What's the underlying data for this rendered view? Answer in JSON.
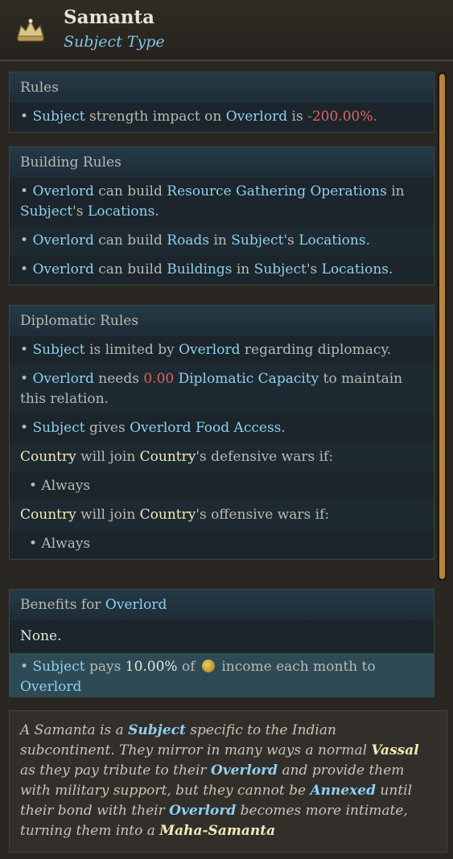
{
  "header": {
    "title": "Samanta",
    "subtitle": "Subject Type",
    "icon": "crown-icon"
  },
  "rules": {
    "heading": "Rules",
    "line1": {
      "bullet": "• ",
      "a": "Subject",
      "b": " strength impact on ",
      "c": "Overlord",
      "d": " is ",
      "e": "-200.00%",
      "f": "."
    }
  },
  "building": {
    "heading": "Building Rules",
    "line1": {
      "a": "Overlord",
      "b": " can build ",
      "c": "Resource Gathering Operations",
      "d": " in ",
      "e": "Subject",
      "f": "'s ",
      "g": "Locations",
      "h": "."
    },
    "line2": {
      "a": "Overlord",
      "b": " can build ",
      "c": "Roads",
      "d": " in ",
      "e": "Subject",
      "f": "'s ",
      "g": "Locations",
      "h": "."
    },
    "line3": {
      "a": "Overlord",
      "b": " can build ",
      "c": "Buildings",
      "d": " in ",
      "e": "Subject",
      "f": "'s ",
      "g": "Locations",
      "h": "."
    }
  },
  "diplomatic": {
    "heading": "Diplomatic Rules",
    "line1": {
      "a": "Subject",
      "b": " is limited by ",
      "c": "Overlord",
      "d": " regarding diplomacy."
    },
    "line2": {
      "a": "Overlord",
      "b": " needs ",
      "c": "0.00",
      "d": " ",
      "e": "Diplomatic Capacity",
      "f": " to maintain this relation."
    },
    "line3": {
      "a": "Subject",
      "b": " gives ",
      "c": "Overlord Food Access",
      "d": "."
    },
    "line4": {
      "a": "Country",
      "b": " will join ",
      "c": "Country",
      "d": "'s defensive wars if:"
    },
    "line5": "• Always",
    "line6": {
      "a": "Country",
      "b": " will join ",
      "c": "Country",
      "d": "'s offensive wars if:"
    },
    "line7": "• Always"
  },
  "benefits": {
    "heading_a": "Benefits for ",
    "heading_b": "Overlord",
    "line1": "None.",
    "line2": {
      "a": "Subject",
      "b": " pays ",
      "c": "10.00%",
      "d": " of ",
      "e": " income each month to ",
      "f": "Overlord"
    }
  },
  "description": {
    "p1": "A Samanta is a ",
    "k1": "Subject",
    "p2": " specific to the Indian subcontinent. They mirror in many ways a normal ",
    "k2": "Vassal",
    "p3": " as they pay tribute to their ",
    "k3": "Overlord",
    "p4": " and provide them with military support, but they cannot be ",
    "k4": "Annexed",
    "p5": " until their bond with their ",
    "k5": "Overlord",
    "p6": " becomes more intimate, turning them into a ",
    "k6": "Maha-Samanta"
  },
  "colors": {
    "keyword": "#8ed0f0",
    "negative": "#e06363",
    "country": "#f3e9b8",
    "scroll_thumb": "#b7833a"
  }
}
